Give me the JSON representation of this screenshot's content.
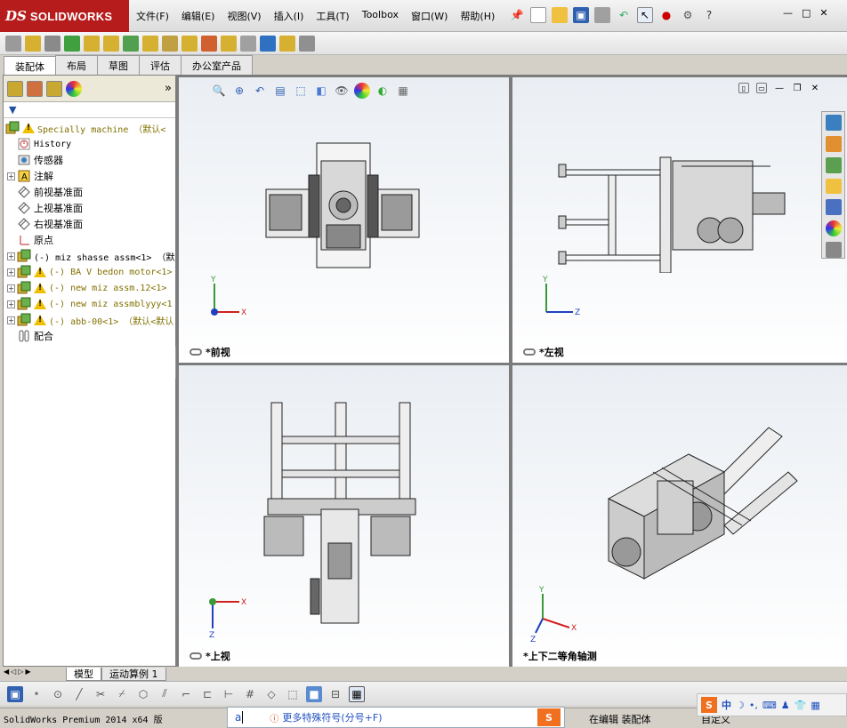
{
  "app": {
    "brand": "SOLIDWORKS",
    "brand_mark": "DS",
    "accent": "#b71c1c"
  },
  "menu": [
    "文件(F)",
    "编辑(E)",
    "视图(V)",
    "插入(I)",
    "工具(T)",
    "Toolbox",
    "窗口(W)",
    "帮助(H)"
  ],
  "window_controls": {
    "help": "?",
    "min": "—",
    "restore": "□",
    "close": "✕"
  },
  "command_tabs": [
    "装配体",
    "布局",
    "草图",
    "评估",
    "办公室产品"
  ],
  "active_command_tab": 0,
  "tree": {
    "root": "Specially machine （默认<",
    "items": [
      {
        "label": "History",
        "icon": "history-icon",
        "mono": true
      },
      {
        "label": "传感器",
        "icon": "sensor-icon"
      },
      {
        "label": "注解",
        "icon": "annotation-icon",
        "expand": true
      },
      {
        "label": "前视基准面",
        "icon": "plane-icon"
      },
      {
        "label": "上视基准面",
        "icon": "plane-icon"
      },
      {
        "label": "右视基准面",
        "icon": "plane-icon"
      },
      {
        "label": "原点",
        "icon": "origin-icon"
      },
      {
        "label": "(-) miz shasse assm<1> （默",
        "icon": "part-icon",
        "expand": true,
        "mono": true
      },
      {
        "label": "(-) BA V bedon motor<1>",
        "icon": "part-icon",
        "warn": true,
        "expand": true,
        "mono": true,
        "olive": true
      },
      {
        "label": "(-) new miz assm.12<1>",
        "icon": "part-icon",
        "warn": true,
        "expand": true,
        "mono": true,
        "olive": true
      },
      {
        "label": "(-) new miz assmblyyy<1",
        "icon": "part-icon",
        "warn": true,
        "expand": true,
        "mono": true,
        "olive": true
      },
      {
        "label": "(-) abb-00<1> （默认<默认",
        "icon": "part-icon",
        "warn": true,
        "expand": true,
        "mono": true,
        "olive": true
      },
      {
        "label": "配合",
        "icon": "mates-icon"
      }
    ]
  },
  "viewports": {
    "front": {
      "label": "*前视",
      "axes": [
        "Y",
        "X"
      ]
    },
    "left": {
      "label": "*左视",
      "axes": [
        "Y",
        "Z"
      ]
    },
    "top": {
      "label": "*上视",
      "axes": [
        "X",
        "Z"
      ]
    },
    "iso": {
      "label": "*上下二等角轴测",
      "axes": [
        "Y",
        "X",
        "Z"
      ]
    }
  },
  "bottom_tabs": [
    "模型",
    "运动算例 1"
  ],
  "status": {
    "version": "SolidWorks Premium 2014 x64 版",
    "ime_char": "a",
    "ime_hint": "更多特殊符号(分号+F)",
    "right_text": "在编辑 装配体",
    "ime_lang": "中",
    "custom": "自定义"
  }
}
